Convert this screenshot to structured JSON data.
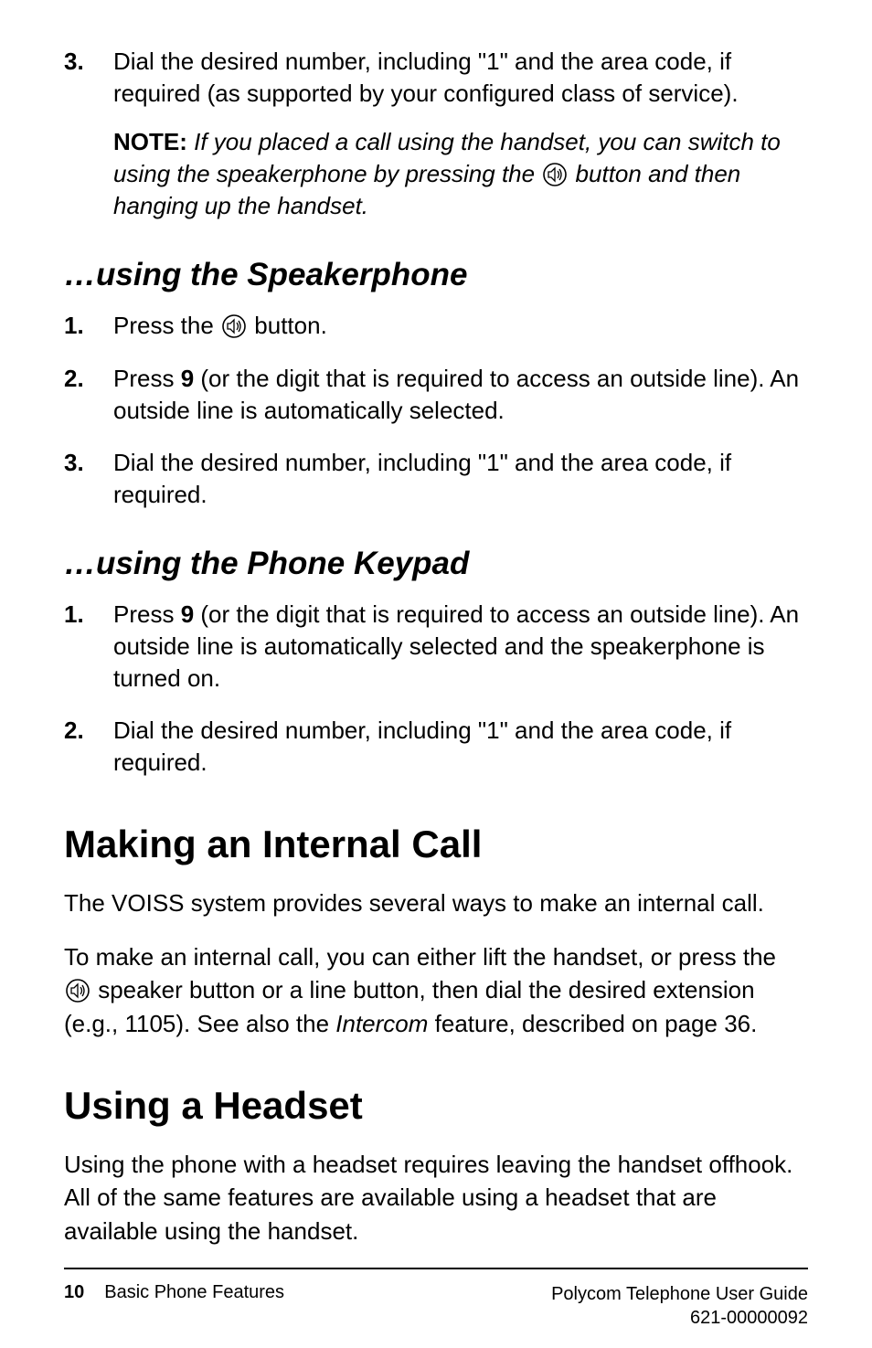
{
  "step3": {
    "num": "3.",
    "text_a": "Dial the desired number, including \"1\" and the area code, if required (as supported by your configured class of service).",
    "note_label": "NOTE:",
    "note_before": " If you placed a call using the handset, you can switch to using the speakerphone by pressing the ",
    "note_after": " button and then hanging up the handset."
  },
  "speakerphone": {
    "heading": "…using the Speakerphone",
    "s1_num": "1.",
    "s1_before": "Press the ",
    "s1_after": " button.",
    "s2_num": "2.",
    "s2_a": "Press ",
    "s2_bold": "9",
    "s2_b": " (or the digit that is required to access an outside line). An outside line is automatically selected.",
    "s3_num": "3.",
    "s3": "Dial the desired number, including \"1\" and the area code, if required."
  },
  "keypad": {
    "heading": "…using the Phone Keypad",
    "s1_num": "1.",
    "s1_a": "Press ",
    "s1_bold": "9",
    "s1_b": " (or the digit that is required to access an outside line). An outside line is automatically selected and the speakerphone is turned on.",
    "s2_num": "2.",
    "s2": "Dial the desired number, including \"1\" and the area code, if required."
  },
  "internal": {
    "heading": "Making an Internal Call",
    "p1": "The VOISS system provides several ways to make an internal call.",
    "p2_a": "To make an internal call, you can either lift the handset, or press the ",
    "p2_b": " speaker button or a line button, then dial the desired extension (e.g., 1105).  See also the ",
    "p2_italic": "Intercom",
    "p2_c": " feature, described on page 36."
  },
  "headset": {
    "heading": "Using a Headset",
    "p1": "Using the phone with a headset requires leaving the handset offhook. All of the same features are available using a headset that are available using the handset."
  },
  "footer": {
    "page": "10",
    "section": "Basic Phone Features",
    "guide": "Polycom Telephone User Guide",
    "docnum": "621-00000092"
  }
}
